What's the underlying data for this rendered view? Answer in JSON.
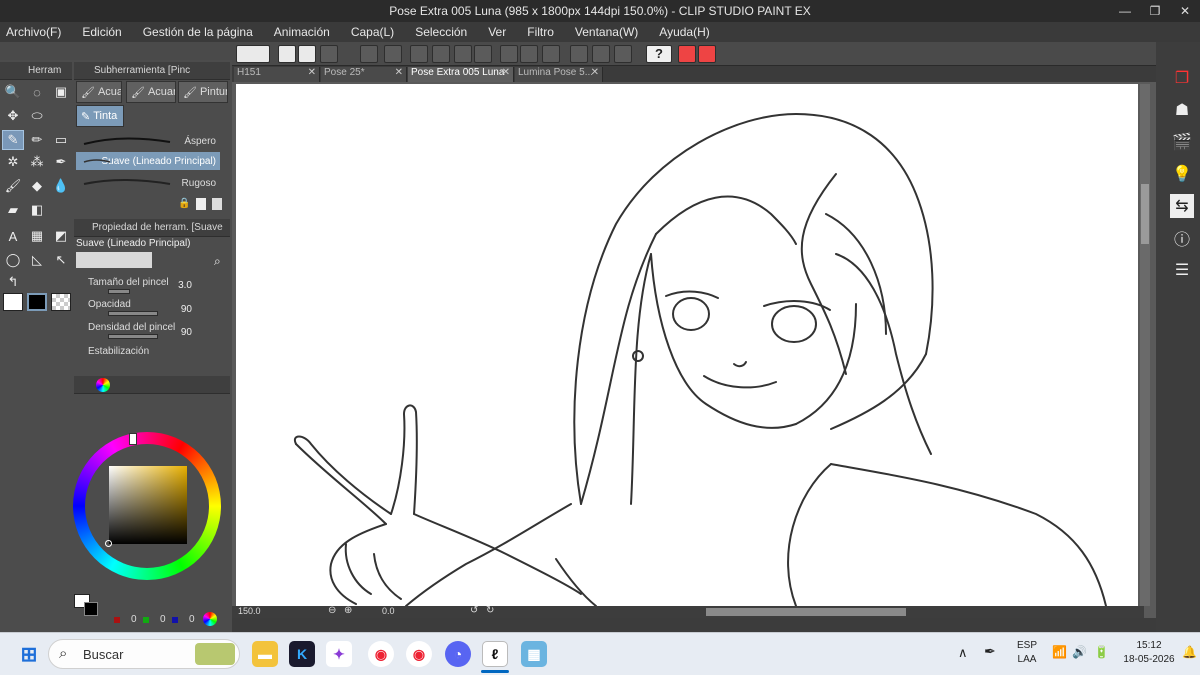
{
  "window": {
    "title": "Pose Extra 005 Luna (985 x 1800px 144dpi 150.0%)  - CLIP STUDIO PAINT EX"
  },
  "menu": [
    "Archivo(F)",
    "Edición",
    "Gestión de la página",
    "Animación",
    "Capa(L)",
    "Selección",
    "Ver",
    "Filtro",
    "Ventana(W)",
    "Ayuda(H)"
  ],
  "tool_panel": {
    "title": "Herram"
  },
  "subtool_panel": {
    "title": "Subherramienta [Pinc",
    "tabs": [
      "Acuar",
      "Acuar",
      "Pintur",
      "Tinta"
    ],
    "brushes": [
      "Áspero",
      "Suave (Lineado Principal)",
      "Rugoso"
    ]
  },
  "property_panel": {
    "title": "Propiedad de herram. [Suave",
    "brush_name": "Suave (Lineado Principal)",
    "rows": [
      {
        "label": "Tamaño del pincel",
        "value": "3.0"
      },
      {
        "label": "Opacidad",
        "value": "90"
      },
      {
        "label": "Densidad del pincel",
        "value": "90"
      },
      {
        "label": "Estabilización",
        "value": ""
      }
    ]
  },
  "color_panel": {
    "swatch_values": [
      "0",
      "0",
      "0"
    ]
  },
  "tabs": [
    "H151",
    "Pose 25*",
    "Pose Extra 005 Luna",
    "Lumina Pose 5..."
  ],
  "status": {
    "zoom": "150.0",
    "angle": "0.0"
  },
  "taskbar": {
    "search_placeholder": "Buscar",
    "lang_1": "ESP",
    "lang_2": "LAA",
    "time": "15:12",
    "date": "18-05-2026"
  },
  "colors": {
    "accent": "#7c9bb8",
    "panel": "#4c4c4c",
    "title": "#2b2b2b"
  }
}
